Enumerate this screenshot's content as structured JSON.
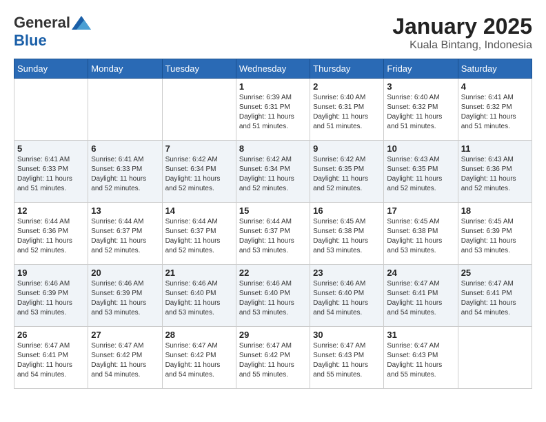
{
  "header": {
    "logo_general": "General",
    "logo_blue": "Blue",
    "month_title": "January 2025",
    "location": "Kuala Bintang, Indonesia"
  },
  "days_of_week": [
    "Sunday",
    "Monday",
    "Tuesday",
    "Wednesday",
    "Thursday",
    "Friday",
    "Saturday"
  ],
  "weeks": [
    [
      {
        "day": "",
        "sunrise": "",
        "sunset": "",
        "daylight": ""
      },
      {
        "day": "",
        "sunrise": "",
        "sunset": "",
        "daylight": ""
      },
      {
        "day": "",
        "sunrise": "",
        "sunset": "",
        "daylight": ""
      },
      {
        "day": "1",
        "sunrise": "Sunrise: 6:39 AM",
        "sunset": "Sunset: 6:31 PM",
        "daylight": "Daylight: 11 hours and 51 minutes."
      },
      {
        "day": "2",
        "sunrise": "Sunrise: 6:40 AM",
        "sunset": "Sunset: 6:31 PM",
        "daylight": "Daylight: 11 hours and 51 minutes."
      },
      {
        "day": "3",
        "sunrise": "Sunrise: 6:40 AM",
        "sunset": "Sunset: 6:32 PM",
        "daylight": "Daylight: 11 hours and 51 minutes."
      },
      {
        "day": "4",
        "sunrise": "Sunrise: 6:41 AM",
        "sunset": "Sunset: 6:32 PM",
        "daylight": "Daylight: 11 hours and 51 minutes."
      }
    ],
    [
      {
        "day": "5",
        "sunrise": "Sunrise: 6:41 AM",
        "sunset": "Sunset: 6:33 PM",
        "daylight": "Daylight: 11 hours and 51 minutes."
      },
      {
        "day": "6",
        "sunrise": "Sunrise: 6:41 AM",
        "sunset": "Sunset: 6:33 PM",
        "daylight": "Daylight: 11 hours and 52 minutes."
      },
      {
        "day": "7",
        "sunrise": "Sunrise: 6:42 AM",
        "sunset": "Sunset: 6:34 PM",
        "daylight": "Daylight: 11 hours and 52 minutes."
      },
      {
        "day": "8",
        "sunrise": "Sunrise: 6:42 AM",
        "sunset": "Sunset: 6:34 PM",
        "daylight": "Daylight: 11 hours and 52 minutes."
      },
      {
        "day": "9",
        "sunrise": "Sunrise: 6:42 AM",
        "sunset": "Sunset: 6:35 PM",
        "daylight": "Daylight: 11 hours and 52 minutes."
      },
      {
        "day": "10",
        "sunrise": "Sunrise: 6:43 AM",
        "sunset": "Sunset: 6:35 PM",
        "daylight": "Daylight: 11 hours and 52 minutes."
      },
      {
        "day": "11",
        "sunrise": "Sunrise: 6:43 AM",
        "sunset": "Sunset: 6:36 PM",
        "daylight": "Daylight: 11 hours and 52 minutes."
      }
    ],
    [
      {
        "day": "12",
        "sunrise": "Sunrise: 6:44 AM",
        "sunset": "Sunset: 6:36 PM",
        "daylight": "Daylight: 11 hours and 52 minutes."
      },
      {
        "day": "13",
        "sunrise": "Sunrise: 6:44 AM",
        "sunset": "Sunset: 6:37 PM",
        "daylight": "Daylight: 11 hours and 52 minutes."
      },
      {
        "day": "14",
        "sunrise": "Sunrise: 6:44 AM",
        "sunset": "Sunset: 6:37 PM",
        "daylight": "Daylight: 11 hours and 52 minutes."
      },
      {
        "day": "15",
        "sunrise": "Sunrise: 6:44 AM",
        "sunset": "Sunset: 6:37 PM",
        "daylight": "Daylight: 11 hours and 53 minutes."
      },
      {
        "day": "16",
        "sunrise": "Sunrise: 6:45 AM",
        "sunset": "Sunset: 6:38 PM",
        "daylight": "Daylight: 11 hours and 53 minutes."
      },
      {
        "day": "17",
        "sunrise": "Sunrise: 6:45 AM",
        "sunset": "Sunset: 6:38 PM",
        "daylight": "Daylight: 11 hours and 53 minutes."
      },
      {
        "day": "18",
        "sunrise": "Sunrise: 6:45 AM",
        "sunset": "Sunset: 6:39 PM",
        "daylight": "Daylight: 11 hours and 53 minutes."
      }
    ],
    [
      {
        "day": "19",
        "sunrise": "Sunrise: 6:46 AM",
        "sunset": "Sunset: 6:39 PM",
        "daylight": "Daylight: 11 hours and 53 minutes."
      },
      {
        "day": "20",
        "sunrise": "Sunrise: 6:46 AM",
        "sunset": "Sunset: 6:39 PM",
        "daylight": "Daylight: 11 hours and 53 minutes."
      },
      {
        "day": "21",
        "sunrise": "Sunrise: 6:46 AM",
        "sunset": "Sunset: 6:40 PM",
        "daylight": "Daylight: 11 hours and 53 minutes."
      },
      {
        "day": "22",
        "sunrise": "Sunrise: 6:46 AM",
        "sunset": "Sunset: 6:40 PM",
        "daylight": "Daylight: 11 hours and 53 minutes."
      },
      {
        "day": "23",
        "sunrise": "Sunrise: 6:46 AM",
        "sunset": "Sunset: 6:40 PM",
        "daylight": "Daylight: 11 hours and 54 minutes."
      },
      {
        "day": "24",
        "sunrise": "Sunrise: 6:47 AM",
        "sunset": "Sunset: 6:41 PM",
        "daylight": "Daylight: 11 hours and 54 minutes."
      },
      {
        "day": "25",
        "sunrise": "Sunrise: 6:47 AM",
        "sunset": "Sunset: 6:41 PM",
        "daylight": "Daylight: 11 hours and 54 minutes."
      }
    ],
    [
      {
        "day": "26",
        "sunrise": "Sunrise: 6:47 AM",
        "sunset": "Sunset: 6:41 PM",
        "daylight": "Daylight: 11 hours and 54 minutes."
      },
      {
        "day": "27",
        "sunrise": "Sunrise: 6:47 AM",
        "sunset": "Sunset: 6:42 PM",
        "daylight": "Daylight: 11 hours and 54 minutes."
      },
      {
        "day": "28",
        "sunrise": "Sunrise: 6:47 AM",
        "sunset": "Sunset: 6:42 PM",
        "daylight": "Daylight: 11 hours and 54 minutes."
      },
      {
        "day": "29",
        "sunrise": "Sunrise: 6:47 AM",
        "sunset": "Sunset: 6:42 PM",
        "daylight": "Daylight: 11 hours and 55 minutes."
      },
      {
        "day": "30",
        "sunrise": "Sunrise: 6:47 AM",
        "sunset": "Sunset: 6:43 PM",
        "daylight": "Daylight: 11 hours and 55 minutes."
      },
      {
        "day": "31",
        "sunrise": "Sunrise: 6:47 AM",
        "sunset": "Sunset: 6:43 PM",
        "daylight": "Daylight: 11 hours and 55 minutes."
      },
      {
        "day": "",
        "sunrise": "",
        "sunset": "",
        "daylight": ""
      }
    ]
  ]
}
